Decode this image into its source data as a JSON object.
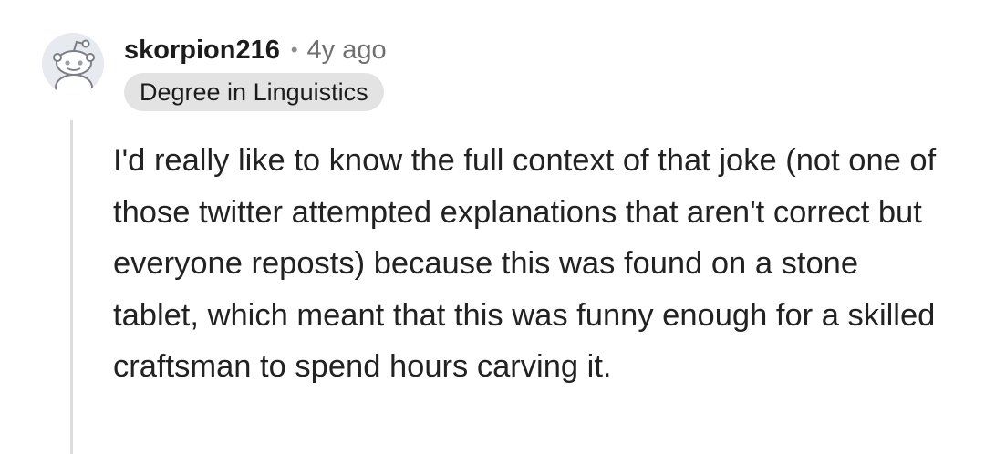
{
  "comment": {
    "author": "skorpion216",
    "separator": "•",
    "age": "4y ago",
    "flair": "Degree in Linguistics",
    "avatar_icon": "snoo-avatar-icon",
    "body": "I'd really like to know the full context of that joke (not one of those twitter attempted explanations that aren't correct but everyone reposts) because this was found on a stone tablet, which meant that this was funny enough for a skilled craftsman to spend hours carving it."
  },
  "colors": {
    "username": "#1c1c1c",
    "meta": "#6f6f6f",
    "flair_bg": "#e3e3e3",
    "thread_line": "#dcdcdc",
    "body_text": "#222222"
  }
}
